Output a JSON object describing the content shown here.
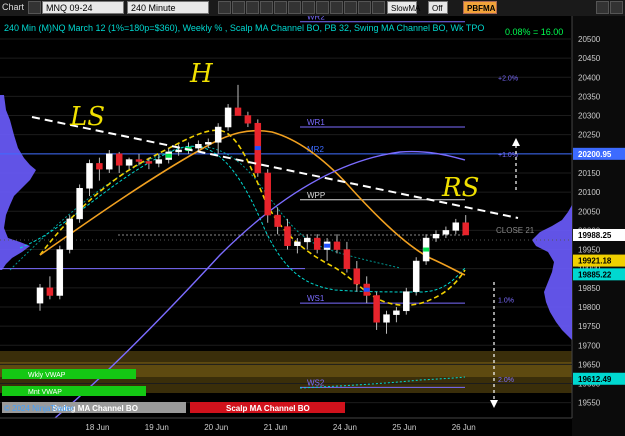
{
  "toolbar": {
    "app_label": "Chart",
    "symbol": "MNQ 09-24",
    "interval": "240 Minute",
    "slow_ma_label": "SlowMA",
    "off_label": "Off",
    "pbfma_label": "PBFMA"
  },
  "chart_data": {
    "type": "candlestick",
    "title": "240 Min (M)NQ March 12 (1%=180p=$360), Weekly % , Scalp MA Channel BO, PB 32, Swing MA Channel BO, Wk TPO",
    "badge": "0.08% = 16.00",
    "y_axis": {
      "ticks": [
        20500,
        20450,
        20400,
        20350,
        20300,
        20250,
        20200,
        20150,
        20100,
        20050,
        20000,
        19950,
        19900,
        19850,
        19800,
        19750,
        19700,
        19650,
        19600,
        19550
      ],
      "ylim": [
        19510,
        20560
      ]
    },
    "x_axis": {
      "labels": [
        {
          "label": "18 Jun",
          "i": 6
        },
        {
          "label": "19 Jun",
          "i": 12
        },
        {
          "label": "20 Jun",
          "i": 18
        },
        {
          "label": "21 Jun",
          "i": 24
        },
        {
          "label": "24 Jun",
          "i": 31
        },
        {
          "label": "25 Jun",
          "i": 37
        },
        {
          "label": "26 Jun",
          "i": 43
        }
      ]
    },
    "candles": [
      [
        19810,
        19860,
        19790,
        19850
      ],
      [
        19850,
        19880,
        19820,
        19830
      ],
      [
        19830,
        19960,
        19820,
        19950
      ],
      [
        19950,
        20040,
        19940,
        20030
      ],
      [
        20030,
        20120,
        20020,
        20110
      ],
      [
        20110,
        20185,
        20090,
        20175
      ],
      [
        20175,
        20190,
        20130,
        20160
      ],
      [
        20160,
        20210,
        20150,
        20200
      ],
      [
        20200,
        20205,
        20150,
        20170
      ],
      [
        20170,
        20190,
        20160,
        20185
      ],
      [
        20185,
        20200,
        20170,
        20180
      ],
      [
        20180,
        20190,
        20160,
        20175
      ],
      [
        20175,
        20200,
        20165,
        20185
      ],
      [
        20185,
        20215,
        20175,
        20205
      ],
      [
        20205,
        20225,
        20195,
        20210
      ],
      [
        20210,
        20230,
        20200,
        20215
      ],
      [
        20215,
        20235,
        20205,
        20225
      ],
      [
        20225,
        20240,
        20215,
        20230
      ],
      [
        20230,
        20280,
        20200,
        20270
      ],
      [
        20270,
        20330,
        20260,
        20320
      ],
      [
        20320,
        20380,
        20300,
        20300
      ],
      [
        20300,
        20310,
        20270,
        20280
      ],
      [
        20280,
        20290,
        20140,
        20150
      ],
      [
        20150,
        20160,
        20020,
        20040
      ],
      [
        20040,
        20060,
        19990,
        20010
      ],
      [
        20010,
        20030,
        19950,
        19960
      ],
      [
        19960,
        19980,
        19940,
        19970
      ],
      [
        19970,
        19990,
        19950,
        19980
      ],
      [
        19980,
        19990,
        19940,
        19950
      ],
      [
        19950,
        19980,
        19920,
        19970
      ],
      [
        19970,
        19990,
        19940,
        19950
      ],
      [
        19950,
        19970,
        19890,
        19900
      ],
      [
        19900,
        19920,
        19840,
        19860
      ],
      [
        19860,
        19880,
        19810,
        19830
      ],
      [
        19830,
        19840,
        19740,
        19760
      ],
      [
        19760,
        19790,
        19730,
        19780
      ],
      [
        19780,
        19800,
        19760,
        19790
      ],
      [
        19790,
        19850,
        19780,
        19840
      ],
      [
        19840,
        19930,
        19830,
        19920
      ],
      [
        19920,
        19990,
        19910,
        19980
      ],
      [
        19980,
        20000,
        19970,
        19990
      ],
      [
        19990,
        20010,
        19980,
        20000
      ],
      [
        20000,
        20030,
        19990,
        20020
      ],
      [
        20020,
        20040,
        19990,
        19988
      ]
    ],
    "candle_colors": {
      "up": "#ffffff",
      "down": "#e8242c",
      "wick": "#bbbbbb"
    },
    "bar_highlights": [
      {
        "i": 13,
        "color": "#00e050"
      },
      {
        "i": 15,
        "color": "#00e050"
      },
      {
        "i": 22,
        "color": "#2050ff"
      },
      {
        "i": 29,
        "color": "#2050ff"
      },
      {
        "i": 33,
        "color": "#2050ff"
      },
      {
        "i": 39,
        "color": "#00e050"
      }
    ],
    "levels": [
      {
        "label": "WR2",
        "value": 20545,
        "color": "#7b6cff"
      },
      {
        "label": "WR1",
        "value": 20270,
        "color": "#7b6cff"
      },
      {
        "label": "MR2",
        "value": 20200,
        "color": "#3d6bff",
        "price_tag": "20200.95",
        "tag_color": "#3d6bff"
      },
      {
        "label": "WPP",
        "value": 20080,
        "color": "#dddddd"
      },
      {
        "label": "CLOSE 21",
        "value": 19988,
        "color": "#888888",
        "price_tag": "19988.25",
        "tag_color": "#ffffff"
      },
      {
        "label": "WS1",
        "value": 19810,
        "color": "#7b6cff"
      },
      {
        "label": "WS2",
        "value": 19590,
        "color": "#7b6cff"
      }
    ],
    "percent_labels": [
      {
        "label": "+2.0%",
        "value": 20400
      },
      {
        "label": "+1.0%",
        "value": 20200
      },
      {
        "label": "1.0%",
        "value": 19820
      },
      {
        "label": "2.0%",
        "value": 19612
      }
    ],
    "price_tags": [
      {
        "value": "19921.18",
        "color": "#f0d000"
      },
      {
        "value": "19885.22",
        "color": "#00d8d0"
      },
      {
        "value": "19612.49",
        "color": "#00d8d0"
      }
    ],
    "vwap_labels": [
      {
        "label": "Wkly VWAP",
        "color": "#14c814"
      },
      {
        "label": "Mnt VWAP",
        "color": "#14c814"
      }
    ],
    "bottom_labels": [
      {
        "label": "Swing MA Channel BO",
        "color": "#aaaaaa"
      },
      {
        "label": "Scalp MA Channel BO",
        "color": "#d0121c"
      }
    ],
    "watermark": "© 2024 NinjaTrader",
    "annotations": [
      "LS",
      "H",
      "RS"
    ]
  }
}
